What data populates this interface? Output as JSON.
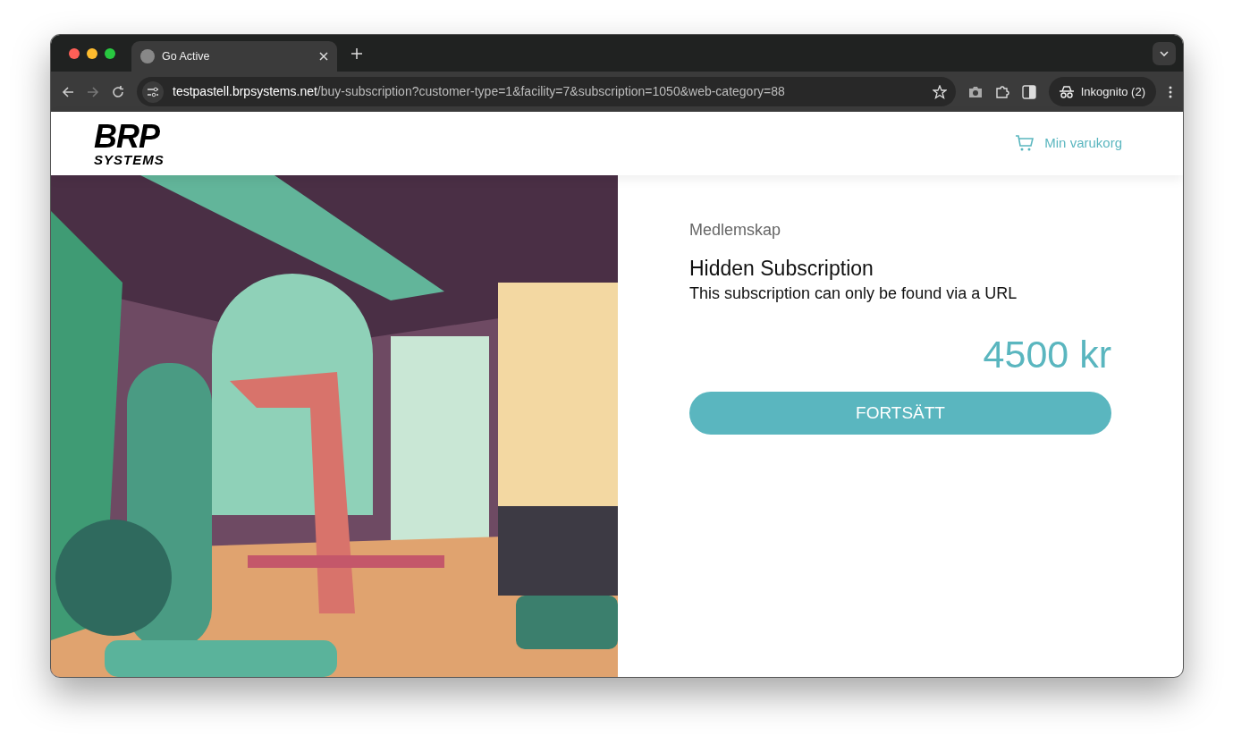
{
  "browser": {
    "tab": {
      "title": "Go Active",
      "selected": true
    },
    "url_host": "testpastell.brpsystems.net",
    "url_path": "/buy-subscription?customer-type=1&facility=7&subscription=1050&web-category=88",
    "profile": "Inkognito (2)"
  },
  "header": {
    "logo": {
      "line_1": "BRP",
      "line_2": "SYSTEMS"
    },
    "cart": "Min varukorg"
  },
  "product": {
    "category": "Medlemskap",
    "title": "Hidden Subscription",
    "description": "This subscription can only be found via a URL",
    "price": "4500 kr",
    "button": "FORTSÄTT"
  }
}
